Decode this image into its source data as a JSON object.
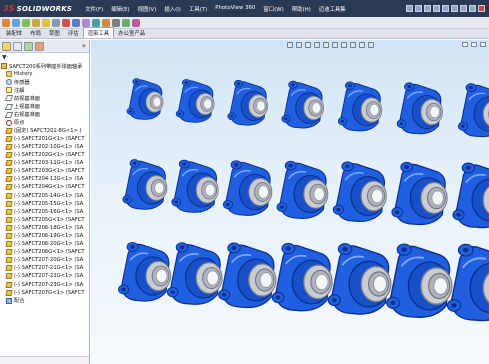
{
  "app": {
    "name": "SOLIDWORKS",
    "menu": [
      "文件(F)",
      "编辑(E)",
      "视图(V)",
      "插入(I)",
      "工具(T)",
      "PhotoView 360",
      "窗口(W)",
      "帮助(H)",
      "迈迪工具集"
    ]
  },
  "command_tabs": {
    "items": [
      "装配体",
      "布局",
      "草图",
      "评估",
      "渲染工具",
      "办公室产品"
    ],
    "active_index": 4
  },
  "feature_tree": {
    "filter_icon": "filter-icon",
    "root": "SAFCT200系列带座外球面轴承",
    "fixed_items": [
      {
        "icon": "folder",
        "label": "History"
      },
      {
        "icon": "sensor",
        "label": "传感器"
      },
      {
        "icon": "anno",
        "label": "注解"
      },
      {
        "icon": "plane",
        "label": "前视基准面"
      },
      {
        "icon": "plane",
        "label": "上视基准面"
      },
      {
        "icon": "plane",
        "label": "右视基准面"
      },
      {
        "icon": "origin",
        "label": "原点"
      }
    ],
    "components": [
      "(固定) SAFCT201-8G<1> (",
      "(-) SAFCT201G<1> (SAFCT",
      "(-) SAFCT202-10G<1> (SA",
      "(-) SAFCT202G<1> (SAFCT",
      "(-) SAFCT203-11G<1> (SA",
      "(-) SAFCT203G<1> (SAFCT",
      "(-) SAFCT204-12G<1> (SA",
      "(-) SAFCT204G<1> (SAFCT",
      "(-) SAFCT205-14G<1> (SA",
      "(-) SAFCT205-15G<1> (SA",
      "(-) SAFCT205-16G<1> (SA",
      "(-) SAFCT205G<1> (SAFCT",
      "(-) SAFCT206-18G<1> (SA",
      "(-) SAFCT206-19G<1> (SA",
      "(-) SAFCT206-20G<1> (SA",
      "(-) SAFCT206G<1> (SAFCT",
      "(-) SAFCT207-20G<1> (SA",
      "(-) SAFCT207-21G<1> (SA",
      "(-) SAFCT207-22G<1> (SA",
      "(-) SAFCT207-23G<1> (SA",
      "(-) SAFCT207G<1> (SAFCT"
    ],
    "mates": "配合"
  },
  "scene": {
    "rows": [
      {
        "count": 7
      },
      {
        "count": 7
      },
      {
        "count": 7
      }
    ],
    "colors": {
      "housing": "#1f5fe0",
      "housing_dark": "#0b2f8a",
      "bearing": "#c9ccd2",
      "bore": "#f4f5f7",
      "background_top": "#cfe4f5",
      "background_bottom": "#f6fafd"
    }
  }
}
